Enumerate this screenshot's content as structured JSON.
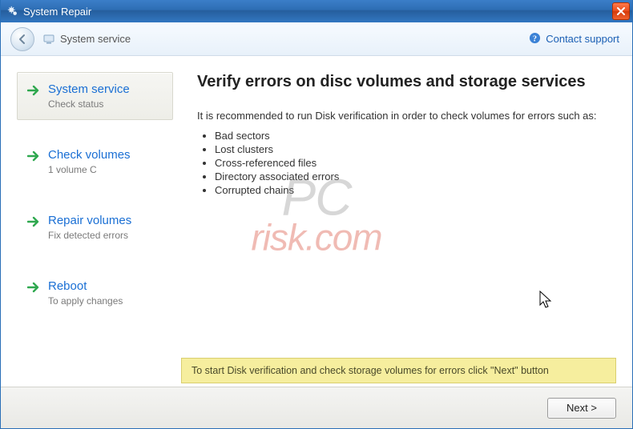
{
  "window": {
    "title": "System Repair"
  },
  "toolbar": {
    "title": "System service",
    "support_label": "Contact support"
  },
  "sidebar": {
    "steps": [
      {
        "title": "System service",
        "subtitle": "Check status",
        "selected": true
      },
      {
        "title": "Check volumes",
        "subtitle": "1 volume C",
        "selected": false
      },
      {
        "title": "Repair volumes",
        "subtitle": "Fix detected errors",
        "selected": false
      },
      {
        "title": "Reboot",
        "subtitle": "To apply changes",
        "selected": false
      }
    ]
  },
  "main": {
    "heading": "Verify errors on disc volumes and storage services",
    "intro": "It is recommended to run Disk verification in order to check volumes for errors such as:",
    "bullets": [
      "Bad sectors",
      "Lost clusters",
      "Cross-referenced files",
      "Directory associated errors",
      "Corrupted chains"
    ],
    "hint": "To start Disk verification and check storage volumes for errors click \"Next\" button"
  },
  "footer": {
    "next_label": "Next >"
  },
  "watermark": {
    "line1": "PC",
    "line2": "risk.com"
  }
}
